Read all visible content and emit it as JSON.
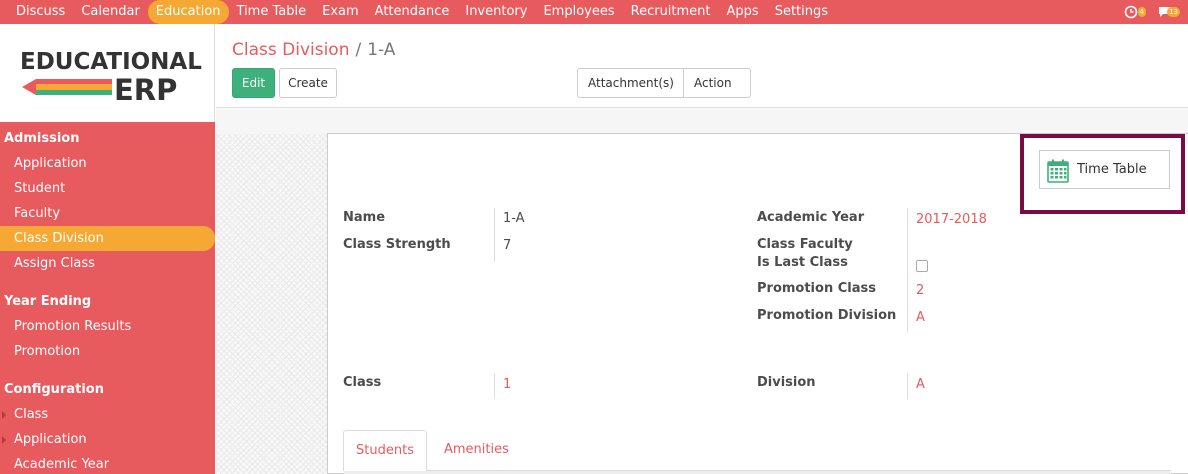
{
  "topnav": {
    "items": [
      {
        "label": "Discuss"
      },
      {
        "label": "Calendar"
      },
      {
        "label": "Education"
      },
      {
        "label": "Time Table"
      },
      {
        "label": "Exam"
      },
      {
        "label": "Attendance"
      },
      {
        "label": "Inventory"
      },
      {
        "label": "Employees"
      },
      {
        "label": "Recruitment"
      },
      {
        "label": "Apps"
      },
      {
        "label": "Settings"
      }
    ],
    "active": "Education",
    "activity_count": "4",
    "message_count": "13"
  },
  "logo": {
    "line1": "EDUCATIONAL",
    "line2": "ERP"
  },
  "sidebar": {
    "sections": [
      {
        "title": "Admission",
        "items": [
          {
            "label": "Application",
            "active": false,
            "caret": false
          },
          {
            "label": "Student",
            "active": false,
            "caret": false
          },
          {
            "label": "Faculty",
            "active": false,
            "caret": false
          },
          {
            "label": "Class Division",
            "active": true,
            "caret": false
          },
          {
            "label": "Assign Class",
            "active": false,
            "caret": false
          }
        ]
      },
      {
        "title": "Year Ending",
        "items": [
          {
            "label": "Promotion Results",
            "active": false,
            "caret": false
          },
          {
            "label": "Promotion",
            "active": false,
            "caret": false
          }
        ]
      },
      {
        "title": "Configuration",
        "items": [
          {
            "label": "Class",
            "active": false,
            "caret": true
          },
          {
            "label": "Application",
            "active": false,
            "caret": true
          },
          {
            "label": "Academic Year",
            "active": false,
            "caret": false
          }
        ]
      }
    ]
  },
  "breadcrumb": {
    "parent": "Class Division",
    "separator": "/",
    "current": "1-A"
  },
  "buttons": {
    "edit": "Edit",
    "create": "Create",
    "attachments": "Attachment(s)",
    "action": "Action"
  },
  "smart_button": {
    "label": "Time Table"
  },
  "form": {
    "name_label": "Name",
    "name_value": "1-A",
    "strength_label": "Class Strength",
    "strength_value": "7",
    "academic_year_label": "Academic Year",
    "academic_year_value": "2017-2018",
    "class_faculty_label": "Class Faculty",
    "is_last_class_label": "Is Last Class",
    "promotion_class_label": "Promotion Class",
    "promotion_class_value": "2",
    "promotion_division_label": "Promotion Division",
    "promotion_division_value": "A",
    "class_label": "Class",
    "class_value": "1",
    "division_label": "Division",
    "division_value": "A"
  },
  "tabs": [
    {
      "label": "Students",
      "active": true
    },
    {
      "label": "Amenities",
      "active": false
    }
  ],
  "colors": {
    "primary": "#e75a5e",
    "accent": "#f5a934",
    "edit": "#3db07b",
    "highlight_frame": "#7c0a45"
  }
}
